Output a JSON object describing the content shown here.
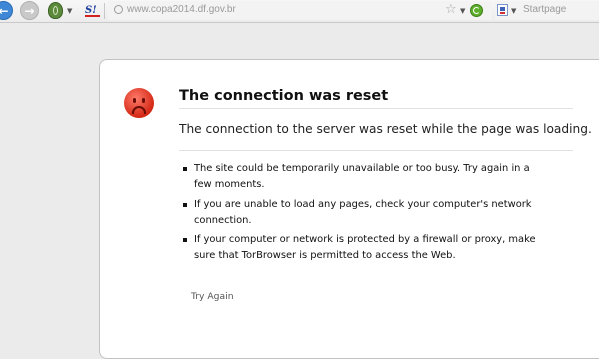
{
  "browser": {
    "address_url": "www.copa2014.df.gov.br",
    "search_placeholder": "Startpage",
    "noscript_label": "S!"
  },
  "error": {
    "title": "The connection was reset",
    "lead": "The connection to the server was reset while the page was loading.",
    "tips": [
      "The site could be temporarily unavailable or too busy. Try again in a few moments.",
      "If you are unable to load any pages, check your computer's network connection.",
      "If your computer or network is protected by a firewall or proxy, make sure that TorBrowser is permitted to access the Web."
    ],
    "retry_label": "Try Again"
  }
}
